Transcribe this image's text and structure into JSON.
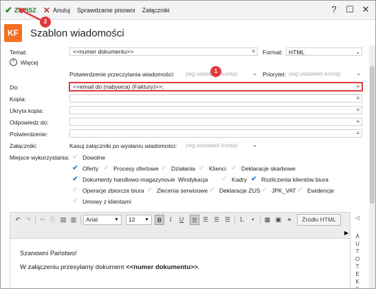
{
  "toolbar": {
    "save": "ZAPISZ",
    "cancel": "Anuluj",
    "spellcheck": "Sprawdzanie pisowni",
    "attachments": "Załączniki",
    "help": "?",
    "minimize": "—",
    "maximize": "☐",
    "close": "✕"
  },
  "header": {
    "logo": "KF",
    "title": "Szablon wiadomości"
  },
  "form": {
    "topic_label": "Temat:",
    "topic_value": "<<numer dokumentu>>",
    "format_label": "Format:",
    "format_value": "HTML",
    "more_label": "Więcej",
    "read_receipt_label": "Potwierdzenie przeczytania wiadomości:",
    "read_receipt_value": "(wg ustawień konta)",
    "priority_label": "Priorytet:",
    "priority_value": "(wg ustawień konta)",
    "to_label": "Do:",
    "to_value": "<<email do (nabywca) (Faktury)>>;",
    "cc_label": "Kopia:",
    "bcc_label": "Ukryta kopia:",
    "reply_to_label": "Odpowiedz do:",
    "confirmation_label": "Potwierdzenie:",
    "attachments_label": "Załączniki:",
    "delete_attachments_label": "Kasuj załączniki po wysłaniu wiadomości:",
    "delete_attachments_value": "(wg ustawień konta)",
    "usage_label": "Miejsce wykorzystania:",
    "usage_any": "Dowolne",
    "usage_options": [
      {
        "label": "Oferty",
        "checked": true
      },
      {
        "label": "Procesy ofertowe",
        "checked": false
      },
      {
        "label": "Działania",
        "checked": false
      },
      {
        "label": "Klienci",
        "checked": false
      },
      {
        "label": "Deklaracje skarbowe",
        "checked": false
      },
      {
        "label": "Dokumenty handlowo-magazynowe",
        "checked": true
      },
      {
        "label": "Windykacja",
        "checked": false
      },
      {
        "label": "Kadry",
        "checked": false
      },
      {
        "label": "Rozliczenia klientów biura",
        "checked": true
      },
      {
        "label": "Operacje zbiorcze biura",
        "checked": false
      },
      {
        "label": "Zlecenia serwisowe",
        "checked": false
      },
      {
        "label": "Deklaracje ZUS",
        "checked": false
      },
      {
        "label": "JPK_VAT",
        "checked": false
      },
      {
        "label": "Ewidencje",
        "checked": false
      },
      {
        "label": "Umowy z klientami",
        "checked": false
      }
    ]
  },
  "editor": {
    "font": "Arial",
    "size": "12",
    "source_label": "Źródło HTML",
    "greeting": "Szanowni Państwo!",
    "line2_prefix": "W załączeniu przesyłamy dokument ",
    "line2_token": "<<numer dokumentu>>",
    "line2_suffix": ".",
    "side_label": "AUTOTEKST"
  },
  "badges": {
    "one": "1",
    "two": "2"
  },
  "colors": {
    "accent_orange": "#f36f21",
    "annotation_red": "#e0393e",
    "check_blue": "#2a7fd4"
  }
}
